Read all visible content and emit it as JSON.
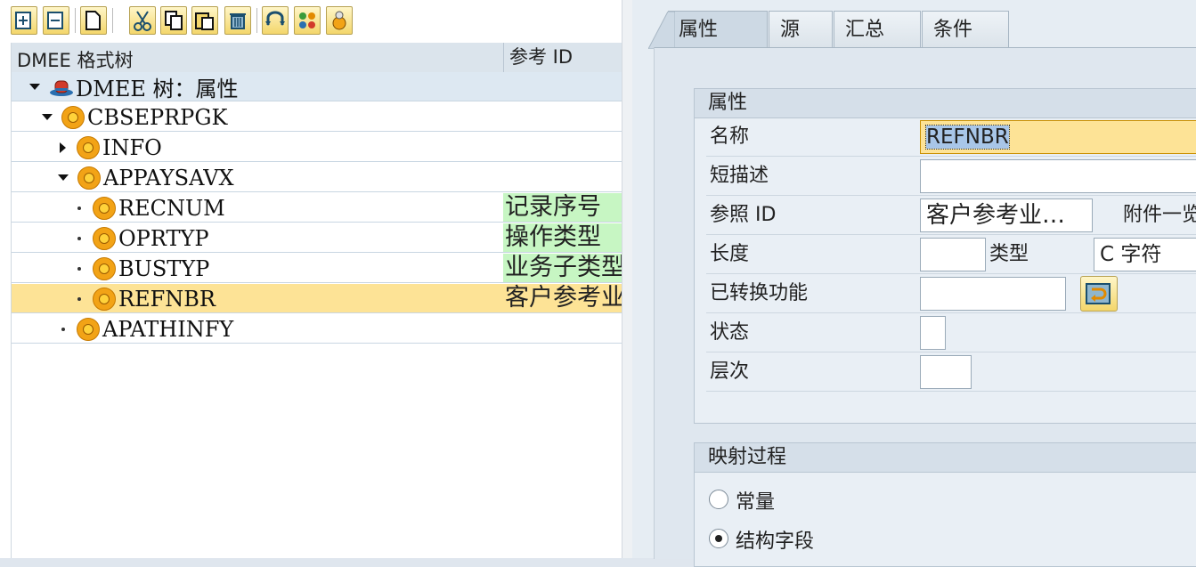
{
  "toolbar": {
    "buttons": [
      "insert-node-icon",
      "delete-node-icon",
      "new-document-icon",
      "cut-icon",
      "copy-icon",
      "paste-icon",
      "delete-icon",
      "swap-icon",
      "nodes-icon",
      "bug-icon"
    ]
  },
  "tree": {
    "col_format_tree": "DMEE 格式树",
    "col_ref_id": "参考 ID",
    "root": "DMEE 树：属性",
    "nodes": [
      {
        "label": "CBSEPRPGK",
        "ref": ""
      },
      {
        "label": "INFO",
        "ref": ""
      },
      {
        "label": "APPAYSAVX",
        "ref": ""
      },
      {
        "label": "RECNUM",
        "ref": "记录序号"
      },
      {
        "label": "OPRTYP",
        "ref": "操作类型"
      },
      {
        "label": "BUSTYP",
        "ref": "业务子类型"
      },
      {
        "label": "REFNBR",
        "ref": "客户参考业"
      },
      {
        "label": "APATHINFY",
        "ref": ""
      }
    ]
  },
  "tabs": [
    "属性",
    "源",
    "汇总",
    "条件"
  ],
  "attributes": {
    "title": "属性",
    "name_label": "名称",
    "name_value": "REFNBR",
    "short_desc_label": "短描述",
    "short_desc_value": "",
    "ref_id_label": "参照 ID",
    "ref_id_value": "客户参考业…",
    "attachment_label": "附件一览",
    "length_label": "长度",
    "length_value": "",
    "type_label": "类型",
    "type_value": "C 字符",
    "conversion_label": "已转换功能",
    "conversion_value": "",
    "status_label": "状态",
    "status_value": "",
    "level_label": "层次",
    "level_value": ""
  },
  "mapping": {
    "title": "映射过程",
    "option_constant": "常量",
    "option_struct_field": "结构字段",
    "selected": "结构字段"
  },
  "colors": {
    "selected_row": "#fde396",
    "ref_highlight": "#c7f6c3",
    "node_icon": "#f2a316"
  }
}
